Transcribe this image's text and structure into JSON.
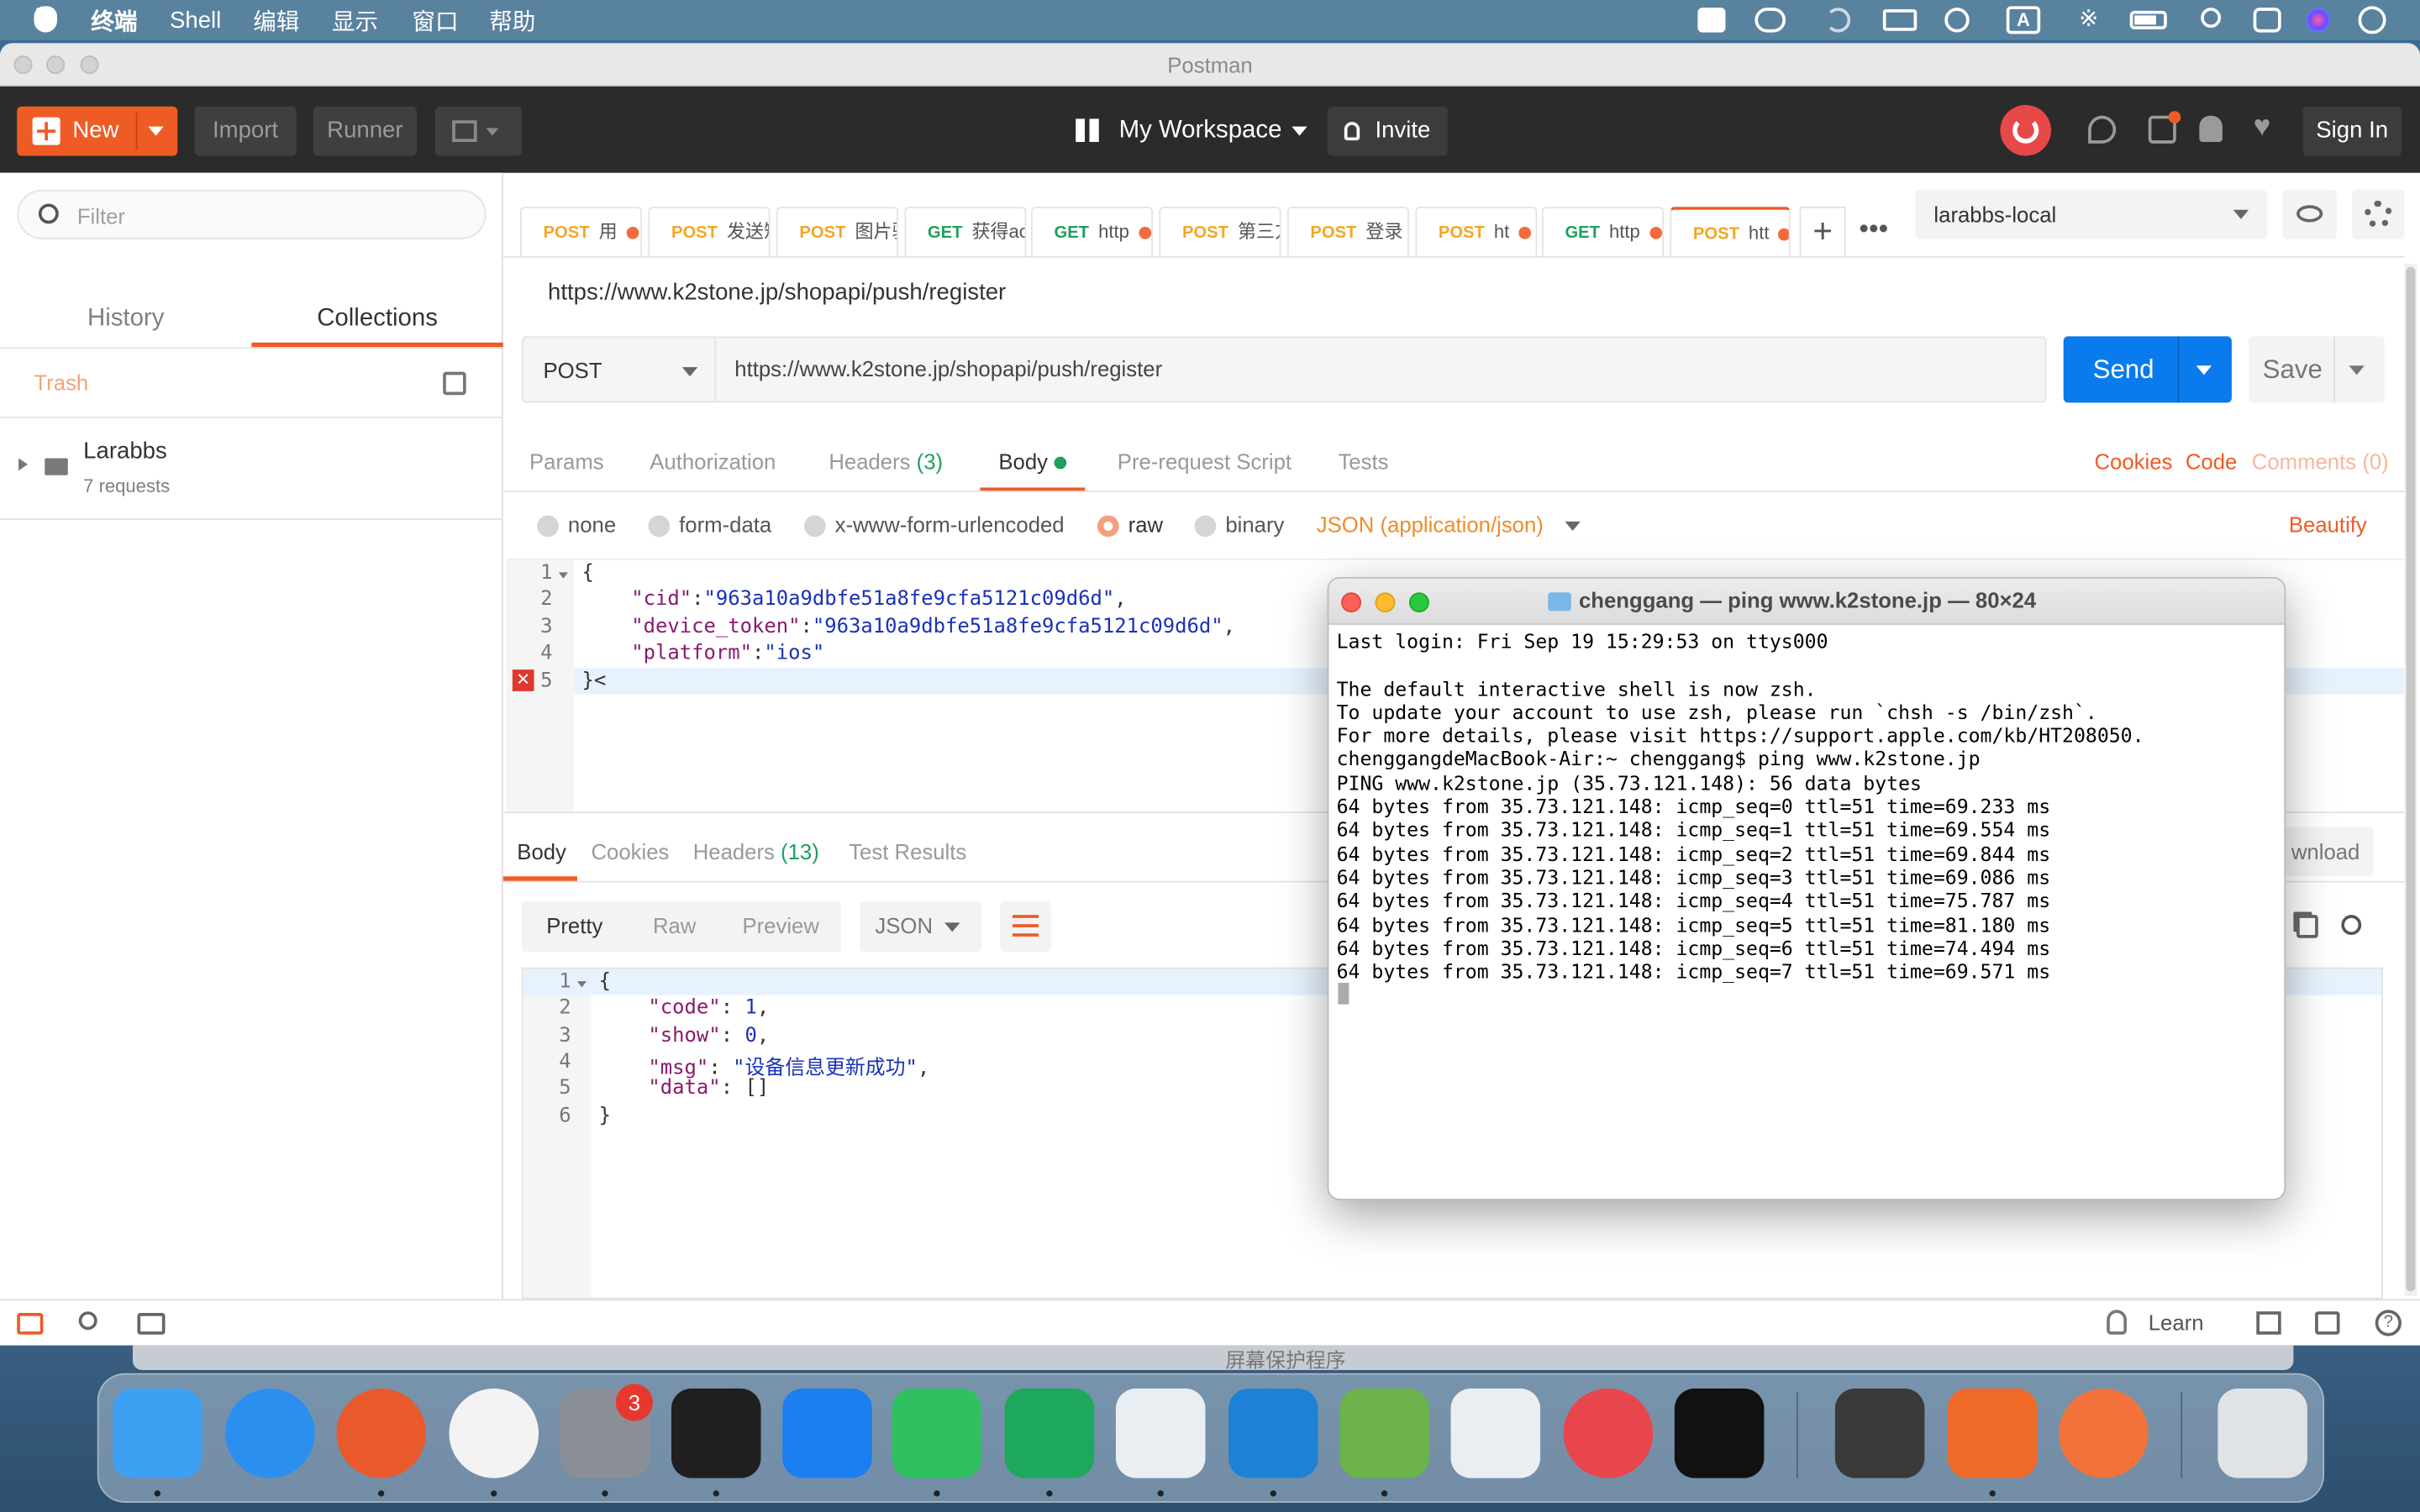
{
  "menubar": {
    "app": "终端",
    "items": [
      "Shell",
      "编辑",
      "显示",
      "窗口",
      "帮助"
    ]
  },
  "window": {
    "title": "Postman"
  },
  "header": {
    "new_label": "New",
    "import_label": "Import",
    "runner_label": "Runner",
    "workspace_label": "My Workspace",
    "invite_label": "Invite",
    "signin_label": "Sign In"
  },
  "sidebar": {
    "filter_placeholder": "Filter",
    "tab_history": "History",
    "tab_collections": "Collections",
    "trash_label": "Trash",
    "collection_name": "Larabbs",
    "collection_count": "7 requests"
  },
  "tabs": [
    {
      "method": "POST",
      "label": "用",
      "dot": true
    },
    {
      "method": "POST",
      "label": "发送短",
      "dot": false
    },
    {
      "method": "POST",
      "label": "图片验",
      "dot": false
    },
    {
      "method": "GET",
      "label": "获得acc",
      "dot": false
    },
    {
      "method": "GET",
      "label": "http",
      "dot": true
    },
    {
      "method": "POST",
      "label": "第三方",
      "dot": false
    },
    {
      "method": "POST",
      "label": "登录",
      "dot": false
    },
    {
      "method": "POST",
      "label": "ht",
      "dot": true
    },
    {
      "method": "GET",
      "label": "http",
      "dot": true
    },
    {
      "method": "POST",
      "label": "htt",
      "dot": true
    }
  ],
  "environment": {
    "selected": "larabbs-local"
  },
  "request": {
    "title": "https://www.k2stone.jp/shopapi/push/register",
    "method": "POST",
    "url": "https://www.k2stone.jp/shopapi/push/register",
    "send_label": "Send",
    "save_label": "Save"
  },
  "request_tabs": {
    "params": "Params",
    "authorization": "Authorization",
    "headers": "Headers",
    "headers_count": "(3)",
    "body": "Body",
    "prerequest": "Pre-request Script",
    "tests": "Tests",
    "cookies": "Cookies",
    "code": "Code",
    "comments": "Comments (0)"
  },
  "body_types": {
    "none": "none",
    "form_data": "form-data",
    "urlencoded": "x-www-form-urlencoded",
    "raw": "raw",
    "binary": "binary",
    "content_type": "JSON (application/json)",
    "beautify": "Beautify"
  },
  "request_body": {
    "lines": [
      "1",
      "2",
      "3",
      "4",
      "5"
    ],
    "open": "{",
    "cid_key": "\"cid\"",
    "cid_val": "\"963a10a9dbfe51a8fe9cfa5121c09d6d\"",
    "token_key": "\"device_token\"",
    "token_val": "\"963a10a9dbfe51a8fe9cfa5121c09d6d\"",
    "platform_key": "\"platform\"",
    "platform_val": "\"ios\"",
    "close": "}<"
  },
  "response_tabs": {
    "body": "Body",
    "cookies": "Cookies",
    "headers": "Headers",
    "headers_count": "(13)",
    "test_results": "Test Results",
    "download": "wnload"
  },
  "response_view": {
    "pretty": "Pretty",
    "raw": "Raw",
    "preview": "Preview",
    "format": "JSON"
  },
  "response_body": {
    "lines": [
      "1",
      "2",
      "3",
      "4",
      "5",
      "6"
    ],
    "open": "{",
    "code_key": "\"code\"",
    "code_val": "1",
    "show_key": "\"show\"",
    "show_val": "0",
    "msg_key": "\"msg\"",
    "msg_val": "\"设备信息更新成功\"",
    "data_key": "\"data\"",
    "data_val": "[]",
    "close": "}"
  },
  "terminal": {
    "title": "chenggang — ping www.k2stone.jp — 80×24",
    "text": "Last login: Fri Sep 19 15:29:53 on ttys000\n\nThe default interactive shell is now zsh.\nTo update your account to use zsh, please run `chsh -s /bin/zsh`.\nFor more details, please visit https://support.apple.com/kb/HT208050.\nchenggangdeMacBook-Air:~ chenggang$ ping www.k2stone.jp\nPING www.k2stone.jp (35.73.121.148): 56 data bytes\n64 bytes from 35.73.121.148: icmp_seq=0 ttl=51 time=69.233 ms\n64 bytes from 35.73.121.148: icmp_seq=1 ttl=51 time=69.554 ms\n64 bytes from 35.73.121.148: icmp_seq=2 ttl=51 time=69.844 ms\n64 bytes from 35.73.121.148: icmp_seq=3 ttl=51 time=69.086 ms\n64 bytes from 35.73.121.148: icmp_seq=4 ttl=51 time=75.787 ms\n64 bytes from 35.73.121.148: icmp_seq=5 ttl=51 time=81.180 ms\n64 bytes from 35.73.121.148: icmp_seq=6 ttl=51 time=74.494 ms\n64 bytes from 35.73.121.148: icmp_seq=7 ttl=51 time=69.571 ms"
  },
  "statusbar": {
    "learn_label": "Learn"
  },
  "behind_window": {
    "label": "屏幕保护程序"
  },
  "dock": {
    "badge": "3",
    "icons": [
      "finder-icon",
      "safari-icon",
      "firefox-icon",
      "chrome-icon",
      "system-preferences-icon",
      "terminal-icon",
      "screen-sharing-icon",
      "wechat-icon",
      "hbuilder-icon",
      "xcode-like-icon",
      "vscode-icon",
      "android-studio-icon",
      "cloud-icon",
      "netease-music-icon",
      "qq-icon",
      "sublime-text-icon",
      "istat-icon",
      "postman-icon",
      "trash-icon"
    ]
  },
  "colors": {
    "accent": "#ef5b25",
    "send_blue": "#097bed",
    "header_bg": "#2b2b2b"
  }
}
